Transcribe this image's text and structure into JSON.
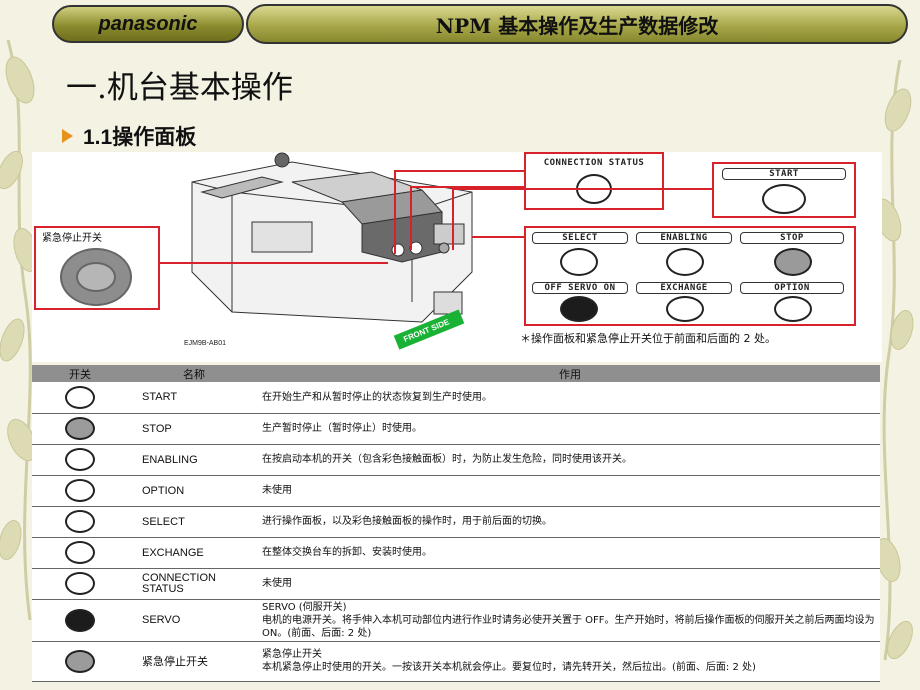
{
  "header": {
    "brand": "panasonic",
    "title": "NPM 基本操作及生产数据修改"
  },
  "section_title": "一.机台基本操作",
  "subsection_title": "1.1操作面板",
  "diagram": {
    "estop_label": "紧急停止开关",
    "connection_title": "CONNECTION STATUS",
    "start_title": "START",
    "panel_labels": [
      "SELECT",
      "ENABLING",
      "STOP",
      "OFF SERVO ON",
      "EXCHANGE",
      "OPTION"
    ],
    "figure_code": "EJM9B-AB01",
    "front_side": "FRONT SIDE",
    "note": "＊操作面板和紧急停止开关位于前面和后面的 2 处。"
  },
  "table": {
    "headers": [
      "开关",
      "名称",
      "作用"
    ],
    "rows": [
      {
        "icon": "start-icon",
        "name": "START",
        "use": "在开始生产和从暂时停止的状态恢复到生产时使用。"
      },
      {
        "icon": "stop-icon",
        "name": "STOP",
        "use": "生产暂时停止（暂时停止）时使用。"
      },
      {
        "icon": "enabling-icon",
        "name": "ENABLING",
        "use": "在按启动本机的开关（包含彩色接触面板）时，为防止发生危险，同时使用该开关。"
      },
      {
        "icon": "option-icon",
        "name": "OPTION",
        "use": "未使用"
      },
      {
        "icon": "select-icon",
        "name": "SELECT",
        "use": "进行操作面板，以及彩色接触面板的操作时，用于前后面的切换。"
      },
      {
        "icon": "exchange-icon",
        "name": "EXCHANGE",
        "use": "在整体交换台车的拆卸、安装时使用。"
      },
      {
        "icon": "connection-status-icon",
        "name": "CONNECTION STATUS",
        "use": "未使用"
      },
      {
        "icon": "servo-icon",
        "name": "SERVO",
        "use": "SERVO (伺服开关)\n电机的电源开关。将手伸入本机可动部位内进行作业时请务必使开关置于 OFF。生产开始时，将前后操作面板的伺服开关之前后两面均设为 ON。(前面、后面: 2 处)"
      },
      {
        "icon": "emergency-stop-icon",
        "name": "紧急停止开关",
        "use": "紧急停止开关\n本机紧急停止时使用的开关。一按该开关本机就会停止。要复位时，请先转开关，然后拉出。(前面、后面: 2 处)"
      }
    ]
  },
  "colors": {
    "accent_red": "#d8222b",
    "bullet": "#e7921c",
    "header_gold": "#a8a84a",
    "front_side_green": "#19b234"
  }
}
